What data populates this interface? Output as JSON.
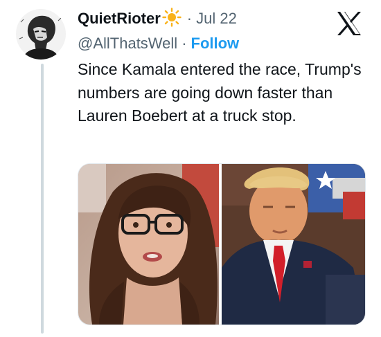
{
  "tweet": {
    "display_name": "QuietRioter",
    "name_emoji": "sun-emoji",
    "date": "Jul 22",
    "handle": "@AllThatsWell",
    "separator": "·",
    "follow_label": "Follow",
    "text": "Since Kamala entered the race, Trump's numbers are going down faster than Lauren Boebert at a truck stop.",
    "media": [
      {
        "kind": "photo",
        "subject": "woman-with-glasses-photo"
      },
      {
        "kind": "photo",
        "subject": "man-in-suit-red-tie-photo"
      }
    ]
  },
  "icons": {
    "platform_logo": "x-logo-icon",
    "avatar": "avatar"
  },
  "colors": {
    "text_primary": "#0f1419",
    "text_secondary": "#536471",
    "follow_blue": "#1d9bf0",
    "thread_line": "#cfd9de"
  }
}
